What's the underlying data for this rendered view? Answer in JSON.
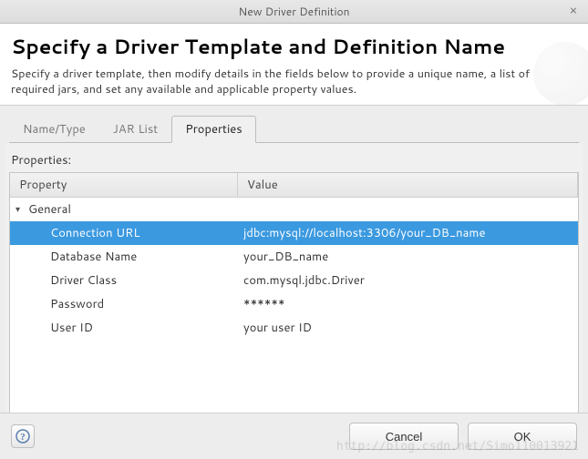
{
  "window": {
    "title": "New Driver Definition"
  },
  "header": {
    "title": "Specify a Driver Template and Definition Name",
    "description": "Specify a driver template, then modify details in the fields below to provide a unique name, a list of required jars, and set any available and applicable property values."
  },
  "tabs": [
    {
      "label": "Name/Type",
      "active": false
    },
    {
      "label": "JAR List",
      "active": false
    },
    {
      "label": "Properties",
      "active": true
    }
  ],
  "properties": {
    "section_label": "Properties:",
    "columns": {
      "property": "Property",
      "value": "Value"
    },
    "category": "General",
    "rows": [
      {
        "name": "Connection URL",
        "value": "jdbc:mysql://localhost:3306/your_DB_name",
        "selected": true
      },
      {
        "name": "Database Name",
        "value": "your_DB_name",
        "selected": false
      },
      {
        "name": "Driver Class",
        "value": "com.mysql.jdbc.Driver",
        "selected": false
      },
      {
        "name": "Password",
        "value": "******",
        "selected": false
      },
      {
        "name": "User ID",
        "value": "your user ID",
        "selected": false
      }
    ]
  },
  "buttons": {
    "cancel": "Cancel",
    "ok": "OK"
  },
  "watermark": "http://blog.csdn.net/Simo110013921"
}
